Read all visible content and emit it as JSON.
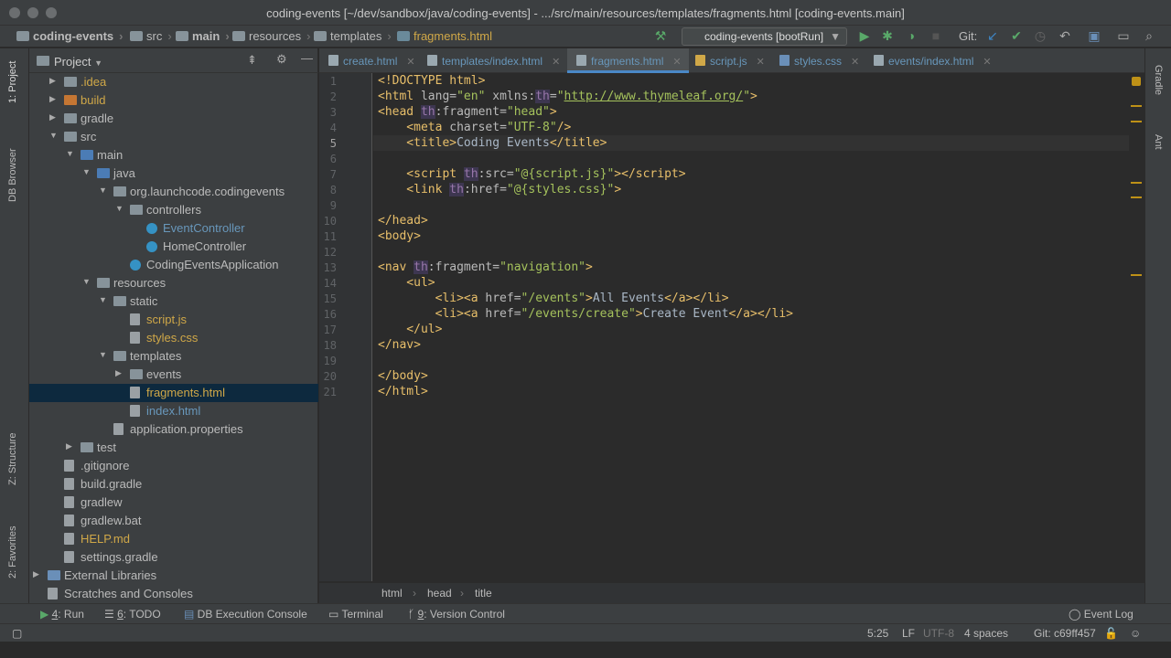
{
  "window": {
    "title": "coding-events [~/dev/sandbox/java/coding-events] - .../src/main/resources/templates/fragments.html [coding-events.main]"
  },
  "navbar": {
    "crumbs": [
      "coding-events",
      "src",
      "main",
      "resources",
      "templates",
      "fragments.html"
    ],
    "run_config": "coding-events [bootRun]",
    "git_label": "Git:"
  },
  "project": {
    "title": "Project",
    "tree": [
      {
        "label": ".idea",
        "color": "#d0a848"
      },
      {
        "label": "build",
        "color": "#d0a848"
      },
      {
        "label": "gradle",
        "color": "#bbbbbb"
      },
      {
        "label": "src",
        "color": "#bbbbbb"
      },
      {
        "label": "main",
        "color": "#bbbbbb"
      },
      {
        "label": "java",
        "color": "#bbbbbb"
      },
      {
        "label": "org.launchcode.codingevents",
        "color": "#bbbbbb"
      },
      {
        "label": "controllers",
        "color": "#bbbbbb"
      },
      {
        "label": "EventController",
        "color": "#6897bb"
      },
      {
        "label": "HomeController",
        "color": "#bbbbbb"
      },
      {
        "label": "CodingEventsApplication",
        "color": "#bbbbbb"
      },
      {
        "label": "resources",
        "color": "#bbbbbb"
      },
      {
        "label": "static",
        "color": "#bbbbbb"
      },
      {
        "label": "script.js",
        "color": "#d0a848"
      },
      {
        "label": "styles.css",
        "color": "#d0a848"
      },
      {
        "label": "templates",
        "color": "#bbbbbb"
      },
      {
        "label": "events",
        "color": "#bbbbbb"
      },
      {
        "label": "fragments.html",
        "color": "#d0a848"
      },
      {
        "label": "index.html",
        "color": "#6897bb"
      },
      {
        "label": "application.properties",
        "color": "#bbbbbb"
      },
      {
        "label": "test",
        "color": "#bbbbbb"
      },
      {
        "label": ".gitignore",
        "color": "#bbbbbb"
      },
      {
        "label": "build.gradle",
        "color": "#bbbbbb"
      },
      {
        "label": "gradlew",
        "color": "#bbbbbb"
      },
      {
        "label": "gradlew.bat",
        "color": "#bbbbbb"
      },
      {
        "label": "HELP.md",
        "color": "#d0a848"
      },
      {
        "label": "settings.gradle",
        "color": "#bbbbbb"
      },
      {
        "label": "External Libraries",
        "color": "#bbbbbb"
      },
      {
        "label": "Scratches and Consoles",
        "color": "#bbbbbb"
      }
    ]
  },
  "tabs": [
    "create.html",
    "templates/index.html",
    "fragments.html",
    "script.js",
    "styles.css",
    "events/index.html"
  ],
  "editor": {
    "line_numbers": [
      "1",
      "2",
      "3",
      "4",
      "5",
      "6",
      "7",
      "8",
      "9",
      "10",
      "11",
      "12",
      "13",
      "14",
      "15",
      "16",
      "17",
      "18",
      "19",
      "20",
      "21"
    ]
  },
  "breadcrumb": [
    "html",
    "head",
    "title"
  ],
  "side_tabs": {
    "project": "1: Project",
    "db_browser": "DB Browser",
    "structure": "Z: Structure",
    "favorites": "2: Favorites",
    "gradle": "Gradle",
    "ant": "Ant"
  },
  "tool_windows": {
    "run_num": "4",
    "run": ": Run",
    "todo_num": "6",
    "todo": ": TODO",
    "db_console": "DB Execution Console",
    "terminal": "Terminal",
    "vc_num": "9",
    "vc": ": Version Control",
    "event_log": "Event Log"
  },
  "status": {
    "position": "5:25",
    "line_sep": "LF",
    "encoding": "UTF-8",
    "indent": "4 spaces",
    "git": "Git: c69ff457"
  }
}
